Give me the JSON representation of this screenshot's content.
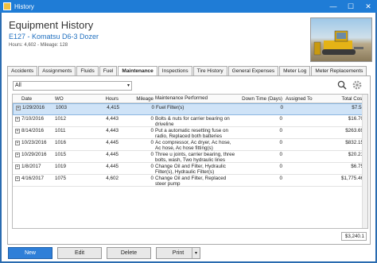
{
  "window": {
    "title": "History",
    "controls": {
      "minimize": "—",
      "maximize": "☐",
      "close": "✕"
    }
  },
  "header": {
    "title": "Equipment History",
    "subtitle": "E127 - Komatsu D6-3 Dozer",
    "meta": "Hours: 4,602 - Mileage: 128"
  },
  "tabs": [
    {
      "label": "Accidents"
    },
    {
      "label": "Assignments"
    },
    {
      "label": "Fluids"
    },
    {
      "label": "Fuel"
    },
    {
      "label": "Maintenance",
      "active": true
    },
    {
      "label": "Inspections"
    },
    {
      "label": "Tire History"
    },
    {
      "label": "General Expenses"
    },
    {
      "label": "Meter Log"
    },
    {
      "label": "Meter Replacements"
    }
  ],
  "filter": {
    "value": "All",
    "caret": "▾"
  },
  "grid": {
    "columns": [
      "Date",
      "WO",
      "Hours",
      "Mileage",
      "Maintenance Performed",
      "Down Time (Days)",
      "Assigned To",
      "Total Cost"
    ],
    "rows": [
      {
        "date": "1/29/2016",
        "wo": "1003",
        "hours": "4,415",
        "mileage": "0",
        "maint": "Fuel Filter(s)",
        "down": "0",
        "assigned": "",
        "cost": "$7.58",
        "selected": true
      },
      {
        "date": "7/10/2016",
        "wo": "1012",
        "hours": "4,443",
        "mileage": "0",
        "maint": "Bolts & nuts for carrier bearing on driveline",
        "down": "0",
        "assigned": "",
        "cost": "$16.70"
      },
      {
        "date": "8/14/2016",
        "wo": "1011",
        "hours": "4,443",
        "mileage": "0",
        "maint": "Put a automatic resetting fuse on radio, Replaced both batteries",
        "down": "0",
        "assigned": "",
        "cost": "$263.69"
      },
      {
        "date": "10/23/2016",
        "wo": "1016",
        "hours": "4,445",
        "mileage": "0",
        "maint": "Ac compressor, Ac dryer, Ac hose, Ac hose, Ac hose fitting(s)",
        "down": "0",
        "assigned": "",
        "cost": "$832.15"
      },
      {
        "date": "10/29/2016",
        "wo": "1015",
        "hours": "4,445",
        "mileage": "0",
        "maint": "Three u joints, carrier bearing, three bolts, wash, Two hydraulic lines",
        "down": "0",
        "assigned": "",
        "cost": "$20.21"
      },
      {
        "date": "1/8/2017",
        "wo": "1019",
        "hours": "4,445",
        "mileage": "0",
        "maint": "Change Oil and Filter, Hydraulic Filter(s), Hydraulic Filter(s)",
        "down": "0",
        "assigned": "",
        "cost": "$6.75"
      },
      {
        "date": "4/16/2017",
        "wo": "1075",
        "hours": "4,602",
        "mileage": "0",
        "maint": "Change Oil and Filter, Replaced steer pump",
        "down": "0",
        "assigned": "",
        "cost": "$1,775.46"
      }
    ],
    "total": "$3,240.1"
  },
  "buttons": {
    "new": "New",
    "edit": "Edit",
    "delete": "Delete",
    "print": "Print",
    "print_dd": "▾"
  },
  "icons": {
    "search": "search-icon",
    "settings": "gear-icon",
    "photo": "dozer-photo"
  },
  "colors": {
    "titlebar": "#1f7cd6",
    "accent": "#2f7fd8",
    "link": "#1f6fbf",
    "selected_row": "#cfe3f7"
  }
}
